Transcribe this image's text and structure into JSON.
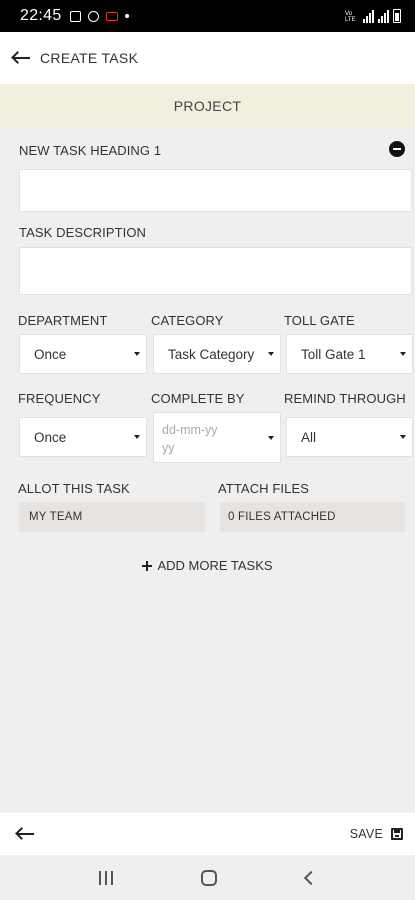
{
  "status_bar": {
    "time": "22:45",
    "volte_text": "Vo LTE"
  },
  "header": {
    "title": "CREATE TASK"
  },
  "project": {
    "label": "PROJECT"
  },
  "form": {
    "task_heading_label": "NEW TASK HEADING 1",
    "task_heading_value": "",
    "task_description_label": "TASK DESCRIPTION",
    "task_description_value": "",
    "department": {
      "label": "DEPARTMENT",
      "value": "Once"
    },
    "category": {
      "label": "CATEGORY",
      "value": "Task Category"
    },
    "toll_gate": {
      "label": "TOLL GATE",
      "value": "Toll Gate 1"
    },
    "frequency": {
      "label": "FREQUENCY",
      "value": "Once"
    },
    "complete_by": {
      "label": "COMPLETE BY",
      "placeholder": "dd-mm-yyyy"
    },
    "remind_through": {
      "label": "REMIND THROUGH",
      "value": "All"
    },
    "allot": {
      "label": "ALLOT THIS TASK",
      "value": "MY TEAM"
    },
    "attach": {
      "label": "ATTACH FILES",
      "value": "0 FILES ATTACHED"
    },
    "add_more_label": "ADD MORE TASKS"
  },
  "bottom_bar": {
    "save_label": "SAVE"
  },
  "colors": {
    "project_bar_bg": "#f1f0dc",
    "page_bg": "#efefef",
    "gray_button_bg": "#e6e3e1",
    "status_bar_bg": "#000000",
    "recording_icon": "#e2353a"
  },
  "icons": [
    "gallery-icon",
    "b-circle-icon",
    "recording-icon",
    "signal-icon",
    "battery-icon",
    "back-arrow-icon",
    "minus-circle-icon",
    "chevron-down-icon",
    "plus-icon",
    "save-floppy-icon",
    "recent-apps-icon",
    "home-icon",
    "nav-back-icon"
  ]
}
